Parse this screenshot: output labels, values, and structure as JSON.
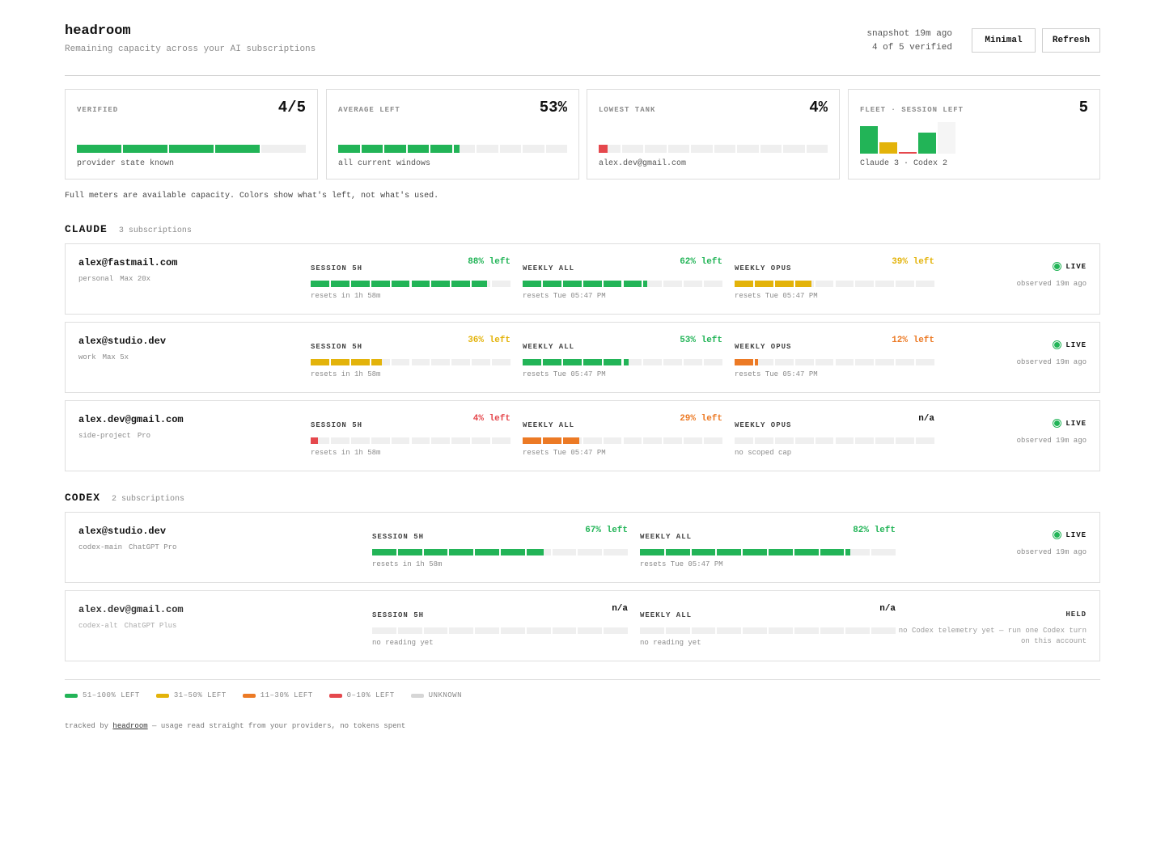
{
  "app": {
    "title": "headroom",
    "subtitle": "Remaining capacity across your AI subscriptions",
    "snapshot": "snapshot 19m ago",
    "verified": "4 of 5 verified",
    "minimal_label": "Minimal",
    "refresh_label": "Refresh"
  },
  "colors": {
    "green": "#22b457",
    "yellow": "#e3b30a",
    "orange": "#ec7a25",
    "red": "#e5484d",
    "unknown": "#d6d6d6",
    "empty": "#efefef"
  },
  "summary": {
    "verified": {
      "label": "VERIFIED",
      "value": "4/5",
      "caption": "provider state known",
      "fraction": 0.8,
      "segments": 5,
      "color": "green"
    },
    "average": {
      "label": "AVERAGE LEFT",
      "value": "53%",
      "caption": "all current windows",
      "fraction": 0.53,
      "segments": 10,
      "color": "green"
    },
    "lowest": {
      "label": "LOWEST TANK",
      "value": "4%",
      "caption": "alex.dev@gmail.com",
      "fraction": 0.04,
      "segments": 10,
      "color": "red"
    },
    "fleet": {
      "label": "FLEET · SESSION LEFT",
      "value": "5",
      "caption": "Claude 3 · Codex 2",
      "bars": [
        {
          "percent": 88,
          "color": "green"
        },
        {
          "percent": 36,
          "color": "yellow"
        },
        {
          "percent": 4,
          "color": "red"
        },
        {
          "percent": 67,
          "color": "green"
        },
        {
          "percent": null,
          "color": "unknown"
        }
      ]
    }
  },
  "note": "Full meters are available capacity. Colors show what's left, not what's used.",
  "sections": {
    "claude": {
      "name": "CLAUDE",
      "count": "3 subscriptions",
      "rows": [
        {
          "account": "alex@fastmail.com",
          "tag": "personal",
          "plan": "Max 20x",
          "status": "LIVE",
          "observed": "observed 19m ago",
          "meters": [
            {
              "label": "SESSION 5H",
              "value": "88% left",
              "percent": 88,
              "color": "green",
              "reset": "resets in 1h 58m"
            },
            {
              "label": "WEEKLY ALL",
              "value": "62% left",
              "percent": 62,
              "color": "green",
              "reset": "resets Tue 05:47 PM"
            },
            {
              "label": "WEEKLY OPUS",
              "value": "39% left",
              "percent": 39,
              "color": "yellow",
              "reset": "resets Tue 05:47 PM"
            }
          ]
        },
        {
          "account": "alex@studio.dev",
          "tag": "work",
          "plan": "Max 5x",
          "status": "LIVE",
          "observed": "observed 19m ago",
          "meters": [
            {
              "label": "SESSION 5H",
              "value": "36% left",
              "percent": 36,
              "color": "yellow",
              "reset": "resets in 1h 58m"
            },
            {
              "label": "WEEKLY ALL",
              "value": "53% left",
              "percent": 53,
              "color": "green",
              "reset": "resets Tue 05:47 PM"
            },
            {
              "label": "WEEKLY OPUS",
              "value": "12% left",
              "percent": 12,
              "color": "orange",
              "reset": "resets Tue 05:47 PM"
            }
          ]
        },
        {
          "account": "alex.dev@gmail.com",
          "tag": "side-project",
          "plan": "Pro",
          "status": "LIVE",
          "observed": "observed 19m ago",
          "meters": [
            {
              "label": "SESSION 5H",
              "value": "4% left",
              "percent": 4,
              "color": "red",
              "reset": "resets in 1h 58m"
            },
            {
              "label": "WEEKLY ALL",
              "value": "29% left",
              "percent": 29,
              "color": "orange",
              "reset": "resets Tue 05:47 PM"
            },
            {
              "label": "WEEKLY OPUS",
              "value": "n/a",
              "percent": null,
              "color": "unknown",
              "reset": "no scoped cap"
            }
          ]
        }
      ]
    },
    "codex": {
      "name": "CODEX",
      "count": "2 subscriptions",
      "rows": [
        {
          "account": "alex@studio.dev",
          "tag": "codex-main",
          "plan": "ChatGPT Pro",
          "status": "LIVE",
          "observed": "observed 19m ago",
          "meters": [
            {
              "label": "SESSION 5H",
              "value": "67% left",
              "percent": 67,
              "color": "green",
              "reset": "resets in 1h 58m"
            },
            {
              "label": "WEEKLY ALL",
              "value": "82% left",
              "percent": 82,
              "color": "green",
              "reset": "resets Tue 05:47 PM"
            }
          ]
        },
        {
          "account": "alex.dev@gmail.com",
          "tag": "codex-alt",
          "plan": "ChatGPT Plus",
          "status": "HELD",
          "held_note": "no Codex telemetry yet — run one Codex turn on this account",
          "meters": [
            {
              "label": "SESSION 5H",
              "value": "n/a",
              "percent": null,
              "color": "unknown",
              "reset": "no reading yet"
            },
            {
              "label": "WEEKLY ALL",
              "value": "n/a",
              "percent": null,
              "color": "unknown",
              "reset": "no reading yet"
            }
          ]
        }
      ]
    }
  },
  "legend": [
    {
      "label": "51–100% LEFT",
      "color": "green"
    },
    {
      "label": "31–50% LEFT",
      "color": "yellow"
    },
    {
      "label": "11–30% LEFT",
      "color": "orange"
    },
    {
      "label": "0–10% LEFT",
      "color": "red"
    },
    {
      "label": "UNKNOWN",
      "color": "unknown"
    }
  ],
  "footer": {
    "prefix": "tracked by",
    "link": "headroom",
    "suffix": "— usage read straight from your providers, no tokens spent"
  }
}
